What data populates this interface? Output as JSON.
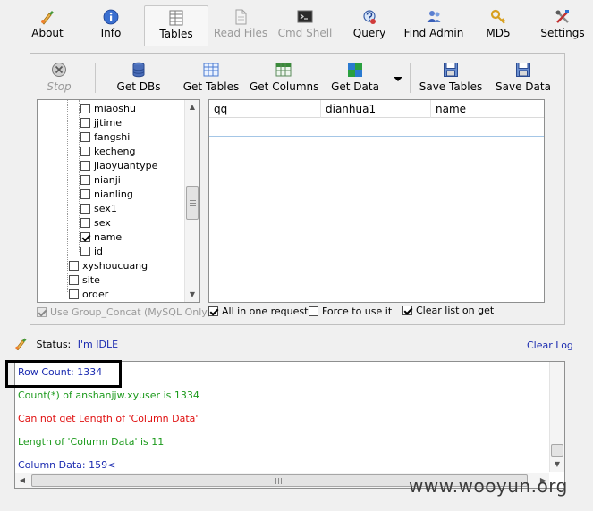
{
  "tabs": [
    {
      "label": "About",
      "icon": "about-icon"
    },
    {
      "label": "Info",
      "icon": "info-icon"
    },
    {
      "label": "Tables",
      "icon": "tables-icon",
      "active": true
    },
    {
      "label": "Read Files",
      "icon": "read-files-icon",
      "disabled": true
    },
    {
      "label": "Cmd Shell",
      "icon": "cmd-shell-icon",
      "disabled": true
    },
    {
      "label": "Query",
      "icon": "query-icon"
    },
    {
      "label": "Find Admin",
      "icon": "find-admin-icon"
    },
    {
      "label": "MD5",
      "icon": "md5-icon"
    },
    {
      "label": "Settings",
      "icon": "settings-icon"
    }
  ],
  "toolbar": {
    "stop": "Stop",
    "get_dbs": "Get DBs",
    "get_tables": "Get Tables",
    "get_columns": "Get Columns",
    "get_data": "Get Data",
    "save_tables": "Save Tables",
    "save_data": "Save Data"
  },
  "tree": {
    "columns": [
      {
        "label": "miaoshu",
        "checked": false
      },
      {
        "label": "jjtime",
        "checked": false
      },
      {
        "label": "fangshi",
        "checked": false
      },
      {
        "label": "kecheng",
        "checked": false
      },
      {
        "label": "jiaoyuantype",
        "checked": false
      },
      {
        "label": "nianji",
        "checked": false
      },
      {
        "label": "nianling",
        "checked": false
      },
      {
        "label": "sex1",
        "checked": false
      },
      {
        "label": "sex",
        "checked": false
      },
      {
        "label": "name",
        "checked": true
      },
      {
        "label": "id",
        "checked": false
      }
    ],
    "tables": [
      {
        "label": "xyshoucuang",
        "checked": false
      },
      {
        "label": "site",
        "checked": false
      },
      {
        "label": "order",
        "checked": false
      }
    ]
  },
  "grid": {
    "columns": [
      "qq",
      "dianhua1",
      "name"
    ]
  },
  "options": {
    "group_concat": "Use Group_Concat (MySQL Only)",
    "all_in_one": "All in one request.",
    "force_use": "Force to use it",
    "clear_list": "Clear list on get"
  },
  "status": {
    "label": "Status:",
    "value": "I'm IDLE",
    "clear_log": "Clear Log"
  },
  "log": [
    {
      "text": "Row Count: 1334",
      "color": "#1b2bb0"
    },
    {
      "text": "Count(*) of anshanjjw.xyuser is 1334",
      "color": "#1c9a1c"
    },
    {
      "text": "Can not get Length of 'Column Data'",
      "color": "#e01010"
    },
    {
      "text": "Length of 'Column Data' is 11",
      "color": "#1c9a1c"
    },
    {
      "text": "Column Data: 159<",
      "color": "#1b2bb0"
    }
  ],
  "watermark": "www.wooyun.org"
}
